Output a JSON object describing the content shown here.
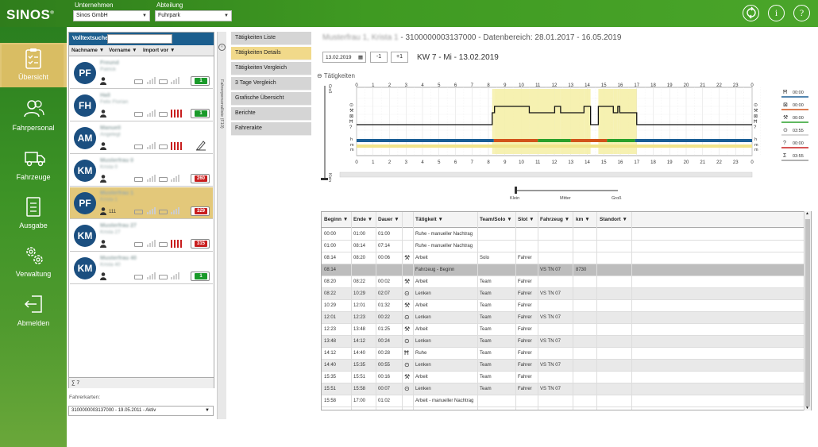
{
  "app": {
    "logo": "SINOS",
    "trademark": "®"
  },
  "topbar": {
    "company_label": "Unternehmen",
    "company_value": "Sinos GmbH",
    "department_label": "Abteilung",
    "department_value": "Fuhrpark",
    "icons": [
      "refresh-icon",
      "info-icon",
      "help-icon"
    ],
    "info_glyph": "i",
    "help_glyph": "?"
  },
  "sidebar": {
    "items": [
      {
        "label": "Übersicht",
        "icon": "clipboard-check-icon",
        "active": true
      },
      {
        "label": "Fahrpersonal",
        "icon": "people-icon",
        "active": false
      },
      {
        "label": "Fahrzeuge",
        "icon": "truck-icon",
        "active": false
      },
      {
        "label": "Ausgabe",
        "icon": "document-icon",
        "active": false
      },
      {
        "label": "Verwaltung",
        "icon": "gears-icon",
        "active": false
      },
      {
        "label": "Abmelden",
        "icon": "logout-icon",
        "active": false
      }
    ]
  },
  "person_list": {
    "search_label": "Volltextsuche",
    "columns": [
      "Nachname",
      "Vorname",
      "Import vor"
    ],
    "rows": [
      {
        "initials": "PF",
        "name": "Freund",
        "sub": "Patrick",
        "badge": "1",
        "badge_color": "#1a9a2a",
        "red_bars": false,
        "extra": "",
        "icon": ""
      },
      {
        "initials": "FH",
        "name": "Hall",
        "sub": "Felix Florian",
        "badge": "1",
        "badge_color": "#1a9a2a",
        "red_bars": true,
        "extra": "",
        "icon": ""
      },
      {
        "initials": "AM",
        "name": "Manuell",
        "sub": "Angelegt",
        "badge": "",
        "badge_color": "",
        "red_bars": true,
        "extra": "",
        "icon": "pen-icon"
      },
      {
        "initials": "KM",
        "name": "Musterfrau 0",
        "sub": "Krista 0",
        "badge": "260",
        "badge_color": "#c81e1e",
        "red_bars": false,
        "extra": "",
        "icon": ""
      },
      {
        "initials": "PF",
        "name": "Musterfrau 1",
        "sub": "Krista 1",
        "badge": "329",
        "badge_color": "#c81e1e",
        "red_bars": false,
        "extra": "111",
        "icon": "",
        "selected": true
      },
      {
        "initials": "KM",
        "name": "Musterfrau 27",
        "sub": "Krista 27",
        "badge": "315",
        "badge_color": "#c81e1e",
        "red_bars": true,
        "extra": "",
        "icon": ""
      },
      {
        "initials": "KM",
        "name": "Musterfrau 40",
        "sub": "Krista 40",
        "badge": "1",
        "badge_color": "#1a9a2a",
        "red_bars": false,
        "extra": "",
        "icon": ""
      }
    ],
    "footer_sum": "∑ 7",
    "driver_cards_label": "Fahrerkarten:",
    "driver_card_value": "3100000003137000 - 19.05.2011 - Aktiv",
    "splitter_label": "Fahrerpersonalliste (F10)"
  },
  "menu": {
    "items": [
      {
        "label": "Tätigkeiten Liste",
        "active": false
      },
      {
        "label": "Tätigkeiten Details",
        "active": true
      },
      {
        "label": "Tätigkeiten Vergleich",
        "active": false
      },
      {
        "label": "3 Tage Vergleich",
        "active": false
      },
      {
        "label": "Grafische Übersicht",
        "active": false
      },
      {
        "label": "Berichte",
        "active": false
      },
      {
        "label": "Fahrerakte",
        "active": false
      }
    ]
  },
  "main": {
    "title_blurred": "Musterfrau 1, Krista 1",
    "title_rest": " - 3100000003137000 - Datenbereich: 28.01.2017 - 16.05.2019",
    "date_value": "13.02.2019",
    "prev_label": "-1",
    "next_label": "+1",
    "kw_label": "KW 7 - Mi - 13.02.2019",
    "section_label": "Tätigkeiten",
    "zoom_labels": [
      "Klein",
      "Mitter",
      "Groß"
    ],
    "vzoom_top": "Groß",
    "vzoom_bottom": "Klein"
  },
  "chart_data": {
    "type": "step-timeline",
    "x_ticks": [
      "0",
      "1",
      "2",
      "3",
      "4",
      "5",
      "6",
      "7",
      "8",
      "9",
      "10",
      "11",
      "12",
      "13",
      "14",
      "15",
      "16",
      "17",
      "18",
      "19",
      "20",
      "21",
      "22",
      "23",
      "0"
    ],
    "xlim": [
      0,
      24
    ],
    "left_row_labels": [
      "Lenken",
      "Arbeit",
      "Bereitschaft",
      "Ruhe",
      "?"
    ],
    "row_markers": [
      "h",
      "m",
      "m"
    ],
    "legend": [
      {
        "icon": "bed-icon",
        "value": "00:00"
      },
      {
        "icon": "standby-icon",
        "value": "00:00"
      },
      {
        "icon": "tools-icon",
        "value": "00:00"
      },
      {
        "icon": "wheel-icon",
        "value": "03:55"
      },
      {
        "icon": "question-icon",
        "value": "00:00"
      },
      {
        "icon": "sum-icon",
        "value": "03:55"
      }
    ],
    "activities": [
      {
        "from": 0.0,
        "to": 8.23,
        "type": "Ruhe"
      },
      {
        "from": 8.23,
        "to": 8.33,
        "type": "Arbeit"
      },
      {
        "from": 8.33,
        "to": 8.37,
        "type": "Arbeit"
      },
      {
        "from": 8.37,
        "to": 10.48,
        "type": "Lenken"
      },
      {
        "from": 10.48,
        "to": 12.02,
        "type": "Arbeit"
      },
      {
        "from": 12.02,
        "to": 12.38,
        "type": "Lenken"
      },
      {
        "from": 12.38,
        "to": 13.8,
        "type": "Arbeit"
      },
      {
        "from": 13.8,
        "to": 14.2,
        "type": "Lenken"
      },
      {
        "from": 14.2,
        "to": 14.67,
        "type": "Ruhe"
      },
      {
        "from": 14.67,
        "to": 15.58,
        "type": "Lenken"
      },
      {
        "from": 15.58,
        "to": 15.85,
        "type": "Arbeit"
      },
      {
        "from": 15.85,
        "to": 15.97,
        "type": "Lenken"
      },
      {
        "from": 15.97,
        "to": 17.0,
        "type": "Arbeit"
      },
      {
        "from": 17.0,
        "to": 24.0,
        "type": "Ruhe"
      }
    ],
    "level_colors": {
      "Lenken": "#f5f0a8",
      "Arbeit": "#f5f0a8",
      "Ruhe": "#fff"
    },
    "bands": {
      "blue": "#1a5e96",
      "segments": [
        {
          "from": 0.0,
          "to": 8.33,
          "color": "#1a5e96"
        },
        {
          "from": 8.33,
          "to": 11.0,
          "color": "#d2531a"
        },
        {
          "from": 11.0,
          "to": 13.0,
          "color": "#2aa02a"
        },
        {
          "from": 13.0,
          "to": 15.2,
          "color": "#d2531a"
        },
        {
          "from": 15.2,
          "to": 16.9,
          "color": "#2aa02a"
        },
        {
          "from": 16.9,
          "to": 24.0,
          "color": "#1a5e96"
        }
      ]
    }
  },
  "table": {
    "headers": [
      "Beginn",
      "Ende",
      "Dauer",
      "",
      "Tätigkeit",
      "Team/Solo",
      "Slot",
      "Fahrzeug",
      "km",
      "Standort"
    ],
    "rows": [
      {
        "b": "00:00",
        "e": "01:00",
        "d": "01:00",
        "ic": "",
        "t": "Ruhe - manueller Nachtrag",
        "ts": "",
        "s": "",
        "f": "",
        "km": "",
        "style": ""
      },
      {
        "b": "01:00",
        "e": "08:14",
        "d": "07:14",
        "ic": "",
        "t": "Ruhe - manueller Nachtrag",
        "ts": "",
        "s": "",
        "f": "",
        "km": "",
        "style": ""
      },
      {
        "b": "08:14",
        "e": "08:20",
        "d": "00:06",
        "ic": "tools",
        "t": "Arbeit",
        "ts": "Solo",
        "s": "Fahrer",
        "f": "",
        "km": "",
        "style": ""
      },
      {
        "b": "08:14",
        "e": "",
        "d": "",
        "ic": "",
        "t": "Fahrzeug - Beginn",
        "ts": "",
        "s": "",
        "f": "VS TN 07",
        "km": "8730",
        "style": "grey"
      },
      {
        "b": "08:20",
        "e": "08:22",
        "d": "00:02",
        "ic": "tools",
        "t": "Arbeit",
        "ts": "Team",
        "s": "Fahrer",
        "f": "",
        "km": "",
        "style": ""
      },
      {
        "b": "08:22",
        "e": "10:29",
        "d": "02:07",
        "ic": "wheel",
        "t": "Lenken",
        "ts": "Team",
        "s": "Fahrer",
        "f": "VS TN 07",
        "km": "",
        "style": "alt"
      },
      {
        "b": "10:29",
        "e": "12:01",
        "d": "01:32",
        "ic": "tools",
        "t": "Arbeit",
        "ts": "Team",
        "s": "Fahrer",
        "f": "",
        "km": "",
        "style": ""
      },
      {
        "b": "12:01",
        "e": "12:23",
        "d": "00:22",
        "ic": "wheel",
        "t": "Lenken",
        "ts": "Team",
        "s": "Fahrer",
        "f": "VS TN 07",
        "km": "",
        "style": "alt"
      },
      {
        "b": "12:23",
        "e": "13:48",
        "d": "01:25",
        "ic": "tools",
        "t": "Arbeit",
        "ts": "Team",
        "s": "Fahrer",
        "f": "",
        "km": "",
        "style": ""
      },
      {
        "b": "13:48",
        "e": "14:12",
        "d": "00:24",
        "ic": "wheel",
        "t": "Lenken",
        "ts": "Team",
        "s": "Fahrer",
        "f": "VS TN 07",
        "km": "",
        "style": "alt"
      },
      {
        "b": "14:12",
        "e": "14:40",
        "d": "00:28",
        "ic": "bed",
        "t": "Ruhe",
        "ts": "Team",
        "s": "Fahrer",
        "f": "",
        "km": "",
        "style": ""
      },
      {
        "b": "14:40",
        "e": "15:35",
        "d": "00:55",
        "ic": "wheel",
        "t": "Lenken",
        "ts": "Team",
        "s": "Fahrer",
        "f": "VS TN 07",
        "km": "",
        "style": "alt"
      },
      {
        "b": "15:35",
        "e": "15:51",
        "d": "00:16",
        "ic": "tools",
        "t": "Arbeit",
        "ts": "Team",
        "s": "Fahrer",
        "f": "",
        "km": "",
        "style": ""
      },
      {
        "b": "15:51",
        "e": "15:58",
        "d": "00:07",
        "ic": "wheel",
        "t": "Lenken",
        "ts": "Team",
        "s": "Fahrer",
        "f": "VS TN 07",
        "km": "",
        "style": "alt"
      },
      {
        "b": "15:58",
        "e": "17:00",
        "d": "01:02",
        "ic": "",
        "t": "Arbeit - manueller Nachtrag",
        "ts": "",
        "s": "",
        "f": "",
        "km": "",
        "style": ""
      }
    ]
  }
}
